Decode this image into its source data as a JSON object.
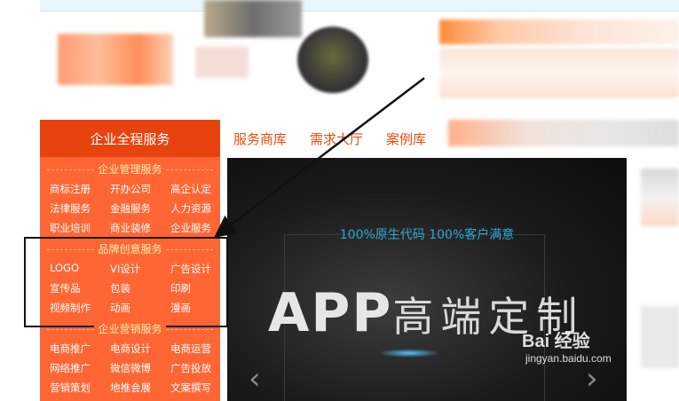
{
  "sidebar": {
    "title": "企业全程服务",
    "categories": [
      {
        "name": "企业管理服务",
        "items": [
          "商标注册",
          "开办公司",
          "高企认定",
          "法律服务",
          "金融服务",
          "人力资源",
          "职业培训",
          "商业装修",
          "企业服务"
        ]
      },
      {
        "name": "品牌创意服务",
        "items": [
          "LOGO",
          "VI设计",
          "广告设计",
          "宣传品",
          "包装",
          "印刷",
          "视频制作",
          "动画",
          "漫画"
        ]
      },
      {
        "name": "企业营销服务",
        "items": [
          "电商推广",
          "电商设计",
          "电商运营",
          "网络推广",
          "微信微博",
          "广告投放",
          "营销策划",
          "地推会展",
          "文案撰写"
        ]
      }
    ]
  },
  "nav": {
    "items": [
      "服务商库",
      "需求大厅",
      "案例库"
    ]
  },
  "banner": {
    "tagline": "100%原生代码  100%客户满意",
    "headline_latin": "APP",
    "headline_cn": "高端定制",
    "prev_icon": "chevron-left-icon",
    "next_icon": "chevron-right-icon"
  },
  "watermark": {
    "main": "Bai 经验",
    "sub": "jingyan.baidu.com"
  },
  "colors": {
    "brand_orange": "#ff6633",
    "header_orange": "#e8430f",
    "nav_text": "#e84d0e",
    "tagline_blue": "#2fa7d8"
  }
}
